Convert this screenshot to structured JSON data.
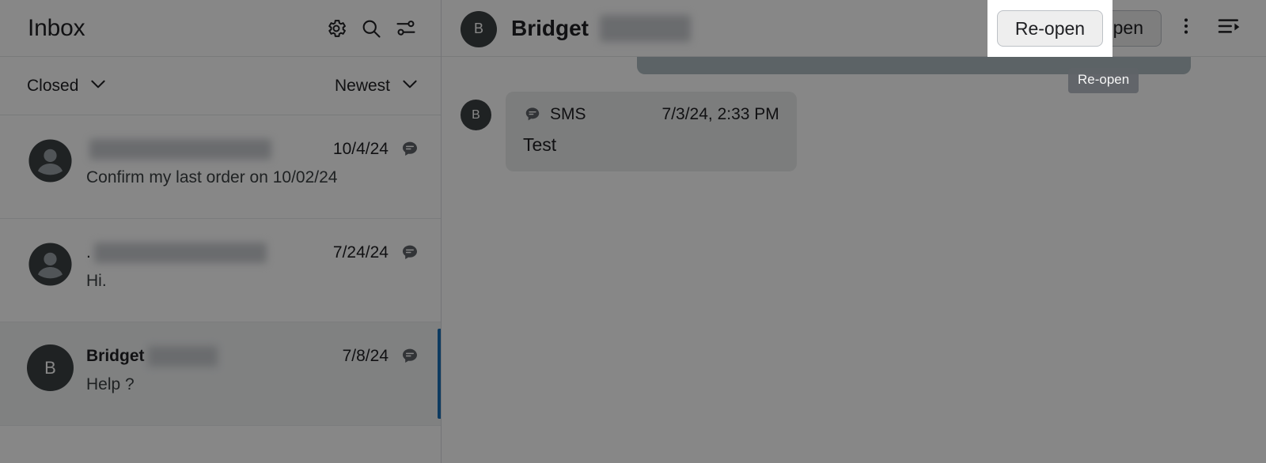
{
  "colors": {
    "accent_selected": "#1a6fb5",
    "avatar_dark": "#3c4043",
    "bubble_incoming": "#ebecec",
    "bubble_outgoing": "#aebbc0",
    "tooltip_bg": "#5f6368",
    "button_bg": "#eeeeee",
    "text_primary": "#202124"
  },
  "list_pane": {
    "title": "Inbox",
    "header_icons": [
      {
        "name": "settings-icon",
        "label": "Settings"
      },
      {
        "name": "search-icon",
        "label": "Search"
      },
      {
        "name": "tune-icon",
        "label": "Filters"
      }
    ],
    "filters": {
      "status": "Closed",
      "sort": "Newest"
    },
    "conversations": [
      {
        "avatar_type": "generic",
        "avatar_initial": "",
        "name": "",
        "name_redacted": true,
        "name_bold": false,
        "redact_width": 230,
        "date": "10/4/24",
        "channel_icon": "sms-bubble-icon",
        "preview": "Confirm my last order on 10/02/24",
        "selected": false
      },
      {
        "avatar_type": "generic",
        "avatar_initial": "",
        "name": ".",
        "name_redacted": true,
        "name_bold": false,
        "redact_width": 218,
        "date": "7/24/24",
        "channel_icon": "sms-bubble-icon",
        "preview": "Hi.",
        "selected": false
      },
      {
        "avatar_type": "initial",
        "avatar_initial": "B",
        "name": "Bridget",
        "name_redacted": true,
        "name_bold": true,
        "redact_width": 88,
        "date": "7/8/24",
        "channel_icon": "sms-bubble-icon",
        "preview": "Help ?",
        "selected": true
      }
    ]
  },
  "detail_pane": {
    "avatar_initial": "B",
    "title": "Bridget",
    "title_redacted": true,
    "title_redact_width": 115,
    "actions": {
      "reopen_label": "Re-open",
      "more_icon": "more-vert-icon",
      "notes_icon": "notes-panel-icon"
    },
    "messages": [
      {
        "partial": true,
        "direction": "outgoing",
        "text": ""
      },
      {
        "partial": false,
        "direction": "incoming",
        "avatar_initial": "B",
        "channel_icon": "sms-bubble-icon",
        "channel": "SMS",
        "timestamp": "7/3/24, 2:33 PM",
        "text": "Test"
      }
    ]
  },
  "overlay": {
    "tooltip_text": "Re-open",
    "spotlight_button_label": "Re-open"
  }
}
